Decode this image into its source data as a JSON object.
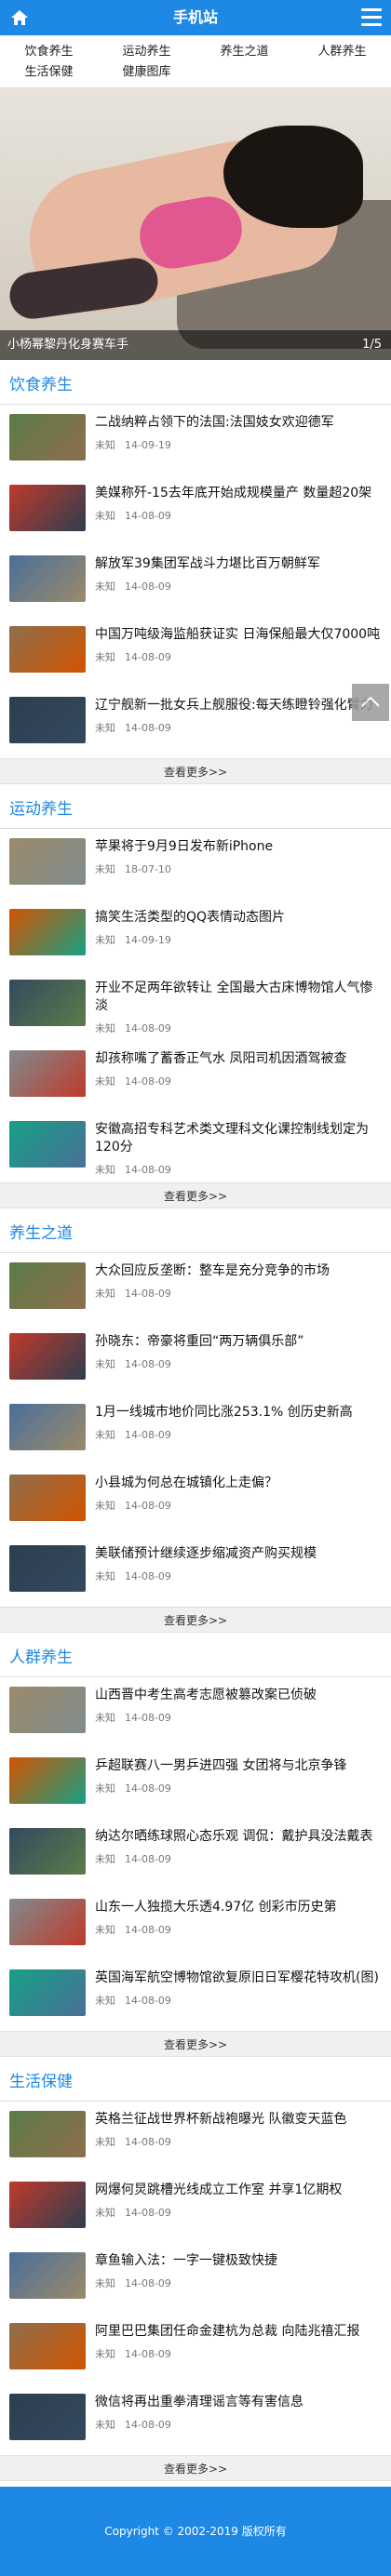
{
  "header": {
    "title": "手机站"
  },
  "nav": {
    "row1": [
      "饮食养生",
      "运动养生",
      "养生之道",
      "人群养生"
    ],
    "row2": [
      "生活保健",
      "健康图库"
    ]
  },
  "banner": {
    "caption": "小杨幂黎丹化身赛车手",
    "pager": "1/5"
  },
  "sections": [
    {
      "title": "饮食养生",
      "more": "查看更多>>",
      "items": [
        {
          "title": "二战纳粹占领下的法国:法国妓女欢迎德军",
          "source": "未知",
          "date": "14-09-19"
        },
        {
          "title": "美媒称歼-15去年底开始成规模量产 数量超20架",
          "source": "未知",
          "date": "14-08-09"
        },
        {
          "title": "解放军39集团军战斗力堪比百万朝鲜军",
          "source": "未知",
          "date": "14-08-09"
        },
        {
          "title": "中国万吨级海监船获证实 日海保船最大仅7000吨",
          "source": "未知",
          "date": "14-08-09"
        },
        {
          "title": "辽宁舰新一批女兵上舰服役:每天练瞪铃强化臂力",
          "source": "未知",
          "date": "14-08-09"
        }
      ]
    },
    {
      "title": "运动养生",
      "more": "查看更多>>",
      "items": [
        {
          "title": "苹果将于9月9日发布新iPhone",
          "source": "未知",
          "date": "18-07-10"
        },
        {
          "title": "搞笑生活类型的QQ表情动态图片",
          "source": "未知",
          "date": "14-09-19"
        },
        {
          "title": "开业不足两年欲转让 全国最大古床博物馆人气惨淡",
          "source": "未知",
          "date": "14-08-09"
        },
        {
          "title": "却孩称嘴了蓄香正气水 凤阳司机因酒驾被查",
          "source": "未知",
          "date": "14-08-09"
        },
        {
          "title": "安徽高招专科艺术类文理科文化课控制线划定为120分",
          "source": "未知",
          "date": "14-08-09"
        }
      ]
    },
    {
      "title": "养生之道",
      "more": "查看更多>>",
      "items": [
        {
          "title": "大众回应反垄断：整车是充分竞争的市场",
          "source": "未知",
          "date": "14-08-09"
        },
        {
          "title": "孙晓东：帝豪将重回“两万辆俱乐部”",
          "source": "未知",
          "date": "14-08-09"
        },
        {
          "title": "1月一线城市地价同比涨253.1% 创历史新高",
          "source": "未知",
          "date": "14-08-09"
        },
        {
          "title": "小县城为何总在城镇化上走偏？",
          "source": "未知",
          "date": "14-08-09"
        },
        {
          "title": "美联储预计继续逐步缩减资产购买规模",
          "source": "未知",
          "date": "14-08-09"
        }
      ]
    },
    {
      "title": "人群养生",
      "more": "查看更多>>",
      "items": [
        {
          "title": "山西晋中考生高考志愿被篡改案已侦破",
          "source": "未知",
          "date": "14-08-09"
        },
        {
          "title": "乒超联赛八一男乒进四强 女团将与北京争锋",
          "source": "未知",
          "date": "14-08-09"
        },
        {
          "title": "纳达尔晒练球照心态乐观 调侃：戴护具没法戴表",
          "source": "未知",
          "date": "14-08-09"
        },
        {
          "title": "山东一人独揽大乐透4.97亿 创彩市历史第",
          "source": "未知",
          "date": "14-08-09"
        },
        {
          "title": "英国海军航空博物馆欲复原旧日军樱花特攻机(图)",
          "source": "未知",
          "date": "14-08-09"
        }
      ]
    },
    {
      "title": "生活保健",
      "more": "查看更多>>",
      "items": [
        {
          "title": "英格兰征战世界杯新战袍曝光 队徽变天蓝色",
          "source": "未知",
          "date": "14-08-09"
        },
        {
          "title": "网爆何炅跳槽光线成立工作室 并享1亿期权",
          "source": "未知",
          "date": "14-08-09"
        },
        {
          "title": "章鱼输入法：一字一键极致快捷",
          "source": "未知",
          "date": "14-08-09"
        },
        {
          "title": "阿里巴巴集团任命金建杭为总裁 向陆兆禧汇报",
          "source": "未知",
          "date": "14-08-09"
        },
        {
          "title": "微信将再出重拳清理谣言等有害信息",
          "source": "未知",
          "date": "14-08-09"
        }
      ]
    }
  ],
  "footer": {
    "copyright": "Copyright © 2002-2019 版权所有"
  },
  "colors": {
    "accent": "#1e88e5"
  }
}
